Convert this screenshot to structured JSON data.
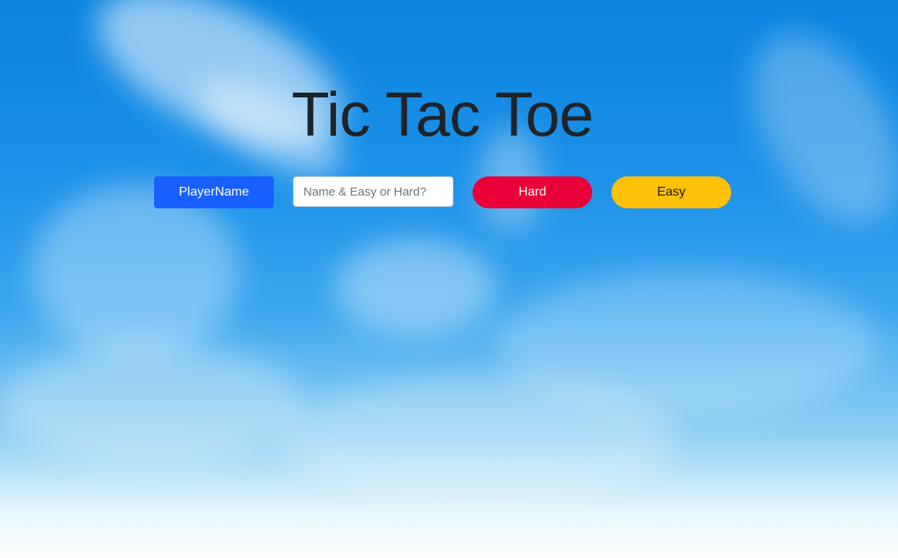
{
  "page": {
    "title": "Tic Tac Toe"
  },
  "controls": {
    "player_name_label": "PlayerName",
    "name_input_value": "",
    "name_input_placeholder": "Name & Easy or Hard?",
    "hard_label": "Hard",
    "easy_label": "Easy"
  },
  "colors": {
    "player_button": "#1860ff",
    "hard_button": "#ea0038",
    "easy_button": "#ffc107",
    "title_text": "#1f2328",
    "sky_top": "#0a84df",
    "sky_bottom": "#ffffff"
  }
}
